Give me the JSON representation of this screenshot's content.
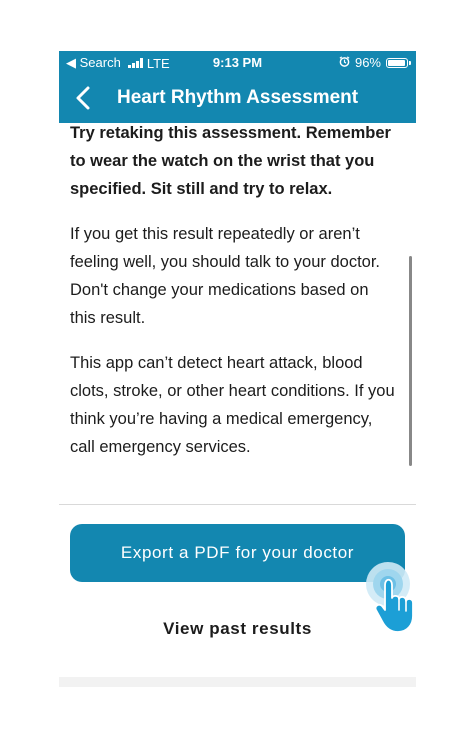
{
  "status_bar": {
    "carrier_back": "◀ Search",
    "network": "LTE",
    "time": "9:13 PM",
    "battery": "96%"
  },
  "nav": {
    "title": "Heart Rhythm Assessment"
  },
  "content": {
    "instruction": "Try retaking this assessment. Remember to wear the watch on the wrist that you specified. Sit still and try to relax.",
    "advice": "If you get this result repeatedly or aren’t feeling well, you should talk to your doctor. Don't change your medications based on this result.",
    "disclaimer": "This app can’t detect heart attack, blood clots, stroke, or other heart conditions. If you think you’re having a medical emergency, call emergency services."
  },
  "actions": {
    "export_label": "Export a PDF for your doctor",
    "past_results_label": "View past results"
  },
  "icons": {
    "back": "chevron-left-icon",
    "alarm": "alarm-icon",
    "battery": "battery-icon",
    "tap": "tap-hand-icon"
  },
  "colors": {
    "brand": "#1387b0",
    "text": "#1c1c1c"
  }
}
